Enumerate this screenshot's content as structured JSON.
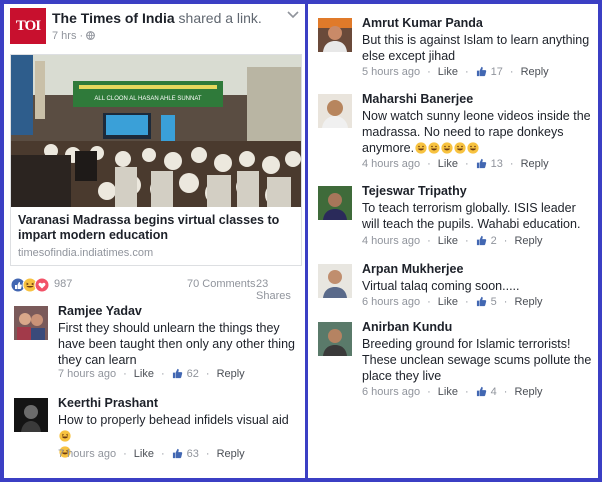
{
  "post": {
    "page_name": "The Times of India",
    "shared_text": "shared a link.",
    "logo_text": "TOI",
    "time": "7 hrs",
    "dot": "·",
    "link_title": "Varanasi Madrassa begins virtual classes to impart modern education",
    "link_domain": "timesofindia.indiatimes.com",
    "image_banner": "ALL CLOON AL HASAN AHLE SUNNAT",
    "reaction_count": "987",
    "comments_count": "70 Comments",
    "shares_count": "23 Shares"
  },
  "labels": {
    "like": "Like",
    "reply": "Reply",
    "dot": "·"
  },
  "comments_left": [
    {
      "name": "Ramjee Yadav",
      "text": "First they should unlearn the things they have been taught then only any other thing they can learn",
      "time": "7 hours ago",
      "likes": "62"
    },
    {
      "name": "Keerthi Prashant",
      "text": "How to properly behead infidels visual aid",
      "time": "7 hours ago",
      "likes": "63"
    }
  ],
  "comments_right": [
    {
      "name": "Amrut Kumar Panda",
      "text": "But this is against Islam to learn anything else except jihad",
      "time": "5 hours ago",
      "likes": "17"
    },
    {
      "name": "Maharshi Banerjee",
      "text": "Now watch sunny leone videos inside the madrassa. No need to rape donkeys anymore.",
      "time": "4 hours ago",
      "likes": "13"
    },
    {
      "name": "Tejeswar Tripathy",
      "text": "To teach terrorism globally. ISIS leader will teach the pupils. Wahabi education.",
      "time": "4 hours ago",
      "likes": "2"
    },
    {
      "name": "Arpan Mukherjee",
      "text": "Virtual talaq coming soon.....",
      "time": "6 hours ago",
      "likes": "5"
    },
    {
      "name": "Anirban Kundu",
      "text": "Breeding ground for Islamic terrorists! These unclean sewage scums pollute the place they live",
      "time": "6 hours ago",
      "likes": "4"
    }
  ],
  "colors": {
    "frame": "#3b3fc4",
    "facebook_blue": "#4267b2",
    "toi_red": "#c8102e"
  }
}
